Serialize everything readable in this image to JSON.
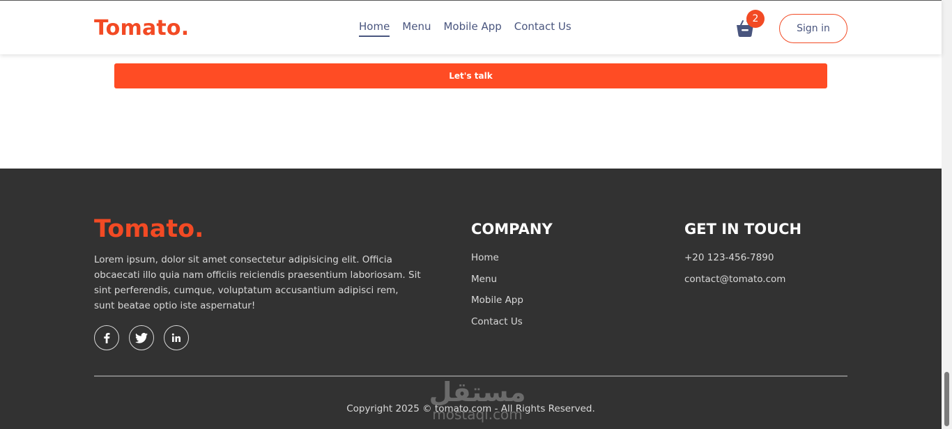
{
  "brand": {
    "name": "Tomato.",
    "accent_color": "#f24a24",
    "text_color": "#49557e",
    "footer_bg": "#323232"
  },
  "header": {
    "nav": [
      {
        "label": "Home",
        "active": true
      },
      {
        "label": "Menu",
        "active": false
      },
      {
        "label": "Mobile App",
        "active": false
      },
      {
        "label": "Contact Us",
        "active": false
      }
    ],
    "basket_icon": "basket-icon",
    "cart_count": "2",
    "signin_label": "Sign in"
  },
  "main": {
    "talk_button_label": "Let's talk"
  },
  "footer": {
    "logo": "Tomato.",
    "description": "Lorem ipsum, dolor sit amet consectetur adipisicing elit. Officia obcaecati illo quia nam officiis reiciendis praesentium laboriosam. Sit sint perferendis, cumque, voluptatum accusantium adipisci rem, sunt beatae optio iste aspernatur!",
    "socials": [
      {
        "icon": "facebook-icon"
      },
      {
        "icon": "twitter-icon"
      },
      {
        "icon": "linkedin-icon"
      }
    ],
    "company": {
      "title": "COMPANY",
      "links": [
        "Home",
        "Menu",
        "Mobile App",
        "Contact Us"
      ]
    },
    "touch": {
      "title": "GET IN TOUCH",
      "phone": "+20 123-456-7890",
      "email": "contact@tomato.com"
    },
    "copyright": "Copyright 2025 © tomato.com - All Rights Reserved.",
    "watermark": {
      "arabic": "مستقل",
      "latin": "mostaql.com"
    }
  }
}
